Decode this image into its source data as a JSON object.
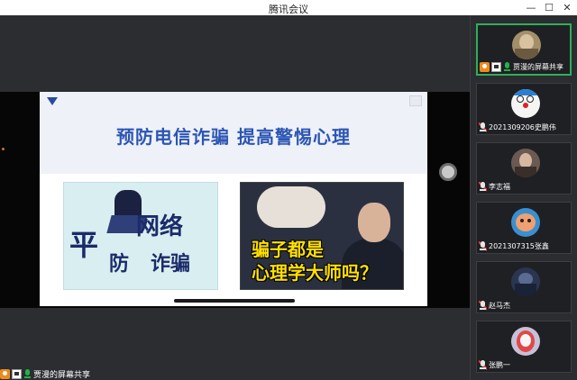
{
  "window": {
    "title": "腾讯会议",
    "minimize": "—",
    "maximize": "☐",
    "close": "✕"
  },
  "slide": {
    "title": "预防电信诈骗 提高警惕心理",
    "left_image": {
      "chars_net": "网络",
      "char_ping": "平",
      "char_fang": "防",
      "chars_zhapian": "诈骗"
    },
    "right_image": {
      "line1": "骗子都是",
      "line2": "心理学大师吗？"
    }
  },
  "share_status": {
    "label": "贾漫的屏幕共享"
  },
  "participants": [
    {
      "name": "贾漫的屏幕共享",
      "type": "sharer",
      "avatar_color": "#a38f6a"
    },
    {
      "name": "2021309206史鹏伟",
      "type": "member",
      "avatar_color": "#f5f5f5"
    },
    {
      "name": "李志福",
      "type": "member",
      "avatar_color": "#6b5a52"
    },
    {
      "name": "2021307315张鑫",
      "type": "member",
      "avatar_color": "#3a8fd0"
    },
    {
      "name": "赵马杰",
      "type": "member",
      "avatar_color": "#2a3550"
    },
    {
      "name": "张鹏一",
      "type": "member",
      "avatar_color": "#c6c0d8"
    }
  ]
}
